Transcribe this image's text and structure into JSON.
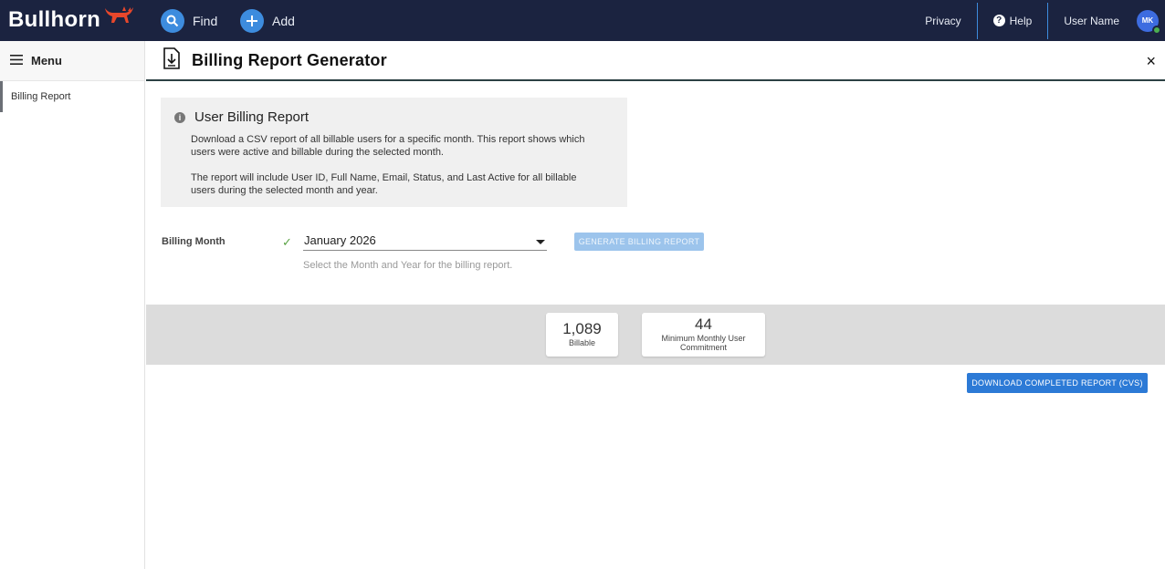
{
  "topbar": {
    "logo_text": "Bullhorn",
    "find_label": "Find",
    "add_label": "Add",
    "privacy_label": "Privacy",
    "help_label": "Help",
    "user_name": "User Name",
    "avatar_initials": "MK",
    "brand_bg": "#1b2340",
    "accent": "#3d8cde"
  },
  "sidebar": {
    "menu_label": "Menu",
    "items": [
      {
        "label": "Billing Report",
        "selected": true
      }
    ]
  },
  "page": {
    "title": "Billing Report Generator",
    "close_glyph": "×"
  },
  "info": {
    "title": "User Billing Report",
    "icon": "info-icon",
    "paragraph1": "Download a CSV report of all billable users for a specific month. This report shows which users were active and billable during the selected month.",
    "paragraph2": "The report will include User ID, Full Name, Email, Status, and Last Active for all billable users during the selected month and year."
  },
  "form": {
    "billing_month_label": "Billing Month",
    "selected_month": "January 2026",
    "helper_text": "Select the Month and Year for the billing report.",
    "generate_label": "GENERATE BILLING REPORT"
  },
  "stats": {
    "billable_value": "1,089",
    "billable_caption": "Billable",
    "commitment_value": "44",
    "commitment_caption": "Minimum Monthly User Commitment"
  },
  "download": {
    "label": "DOWNLOAD COMPLETED REPORT (CVS)"
  }
}
